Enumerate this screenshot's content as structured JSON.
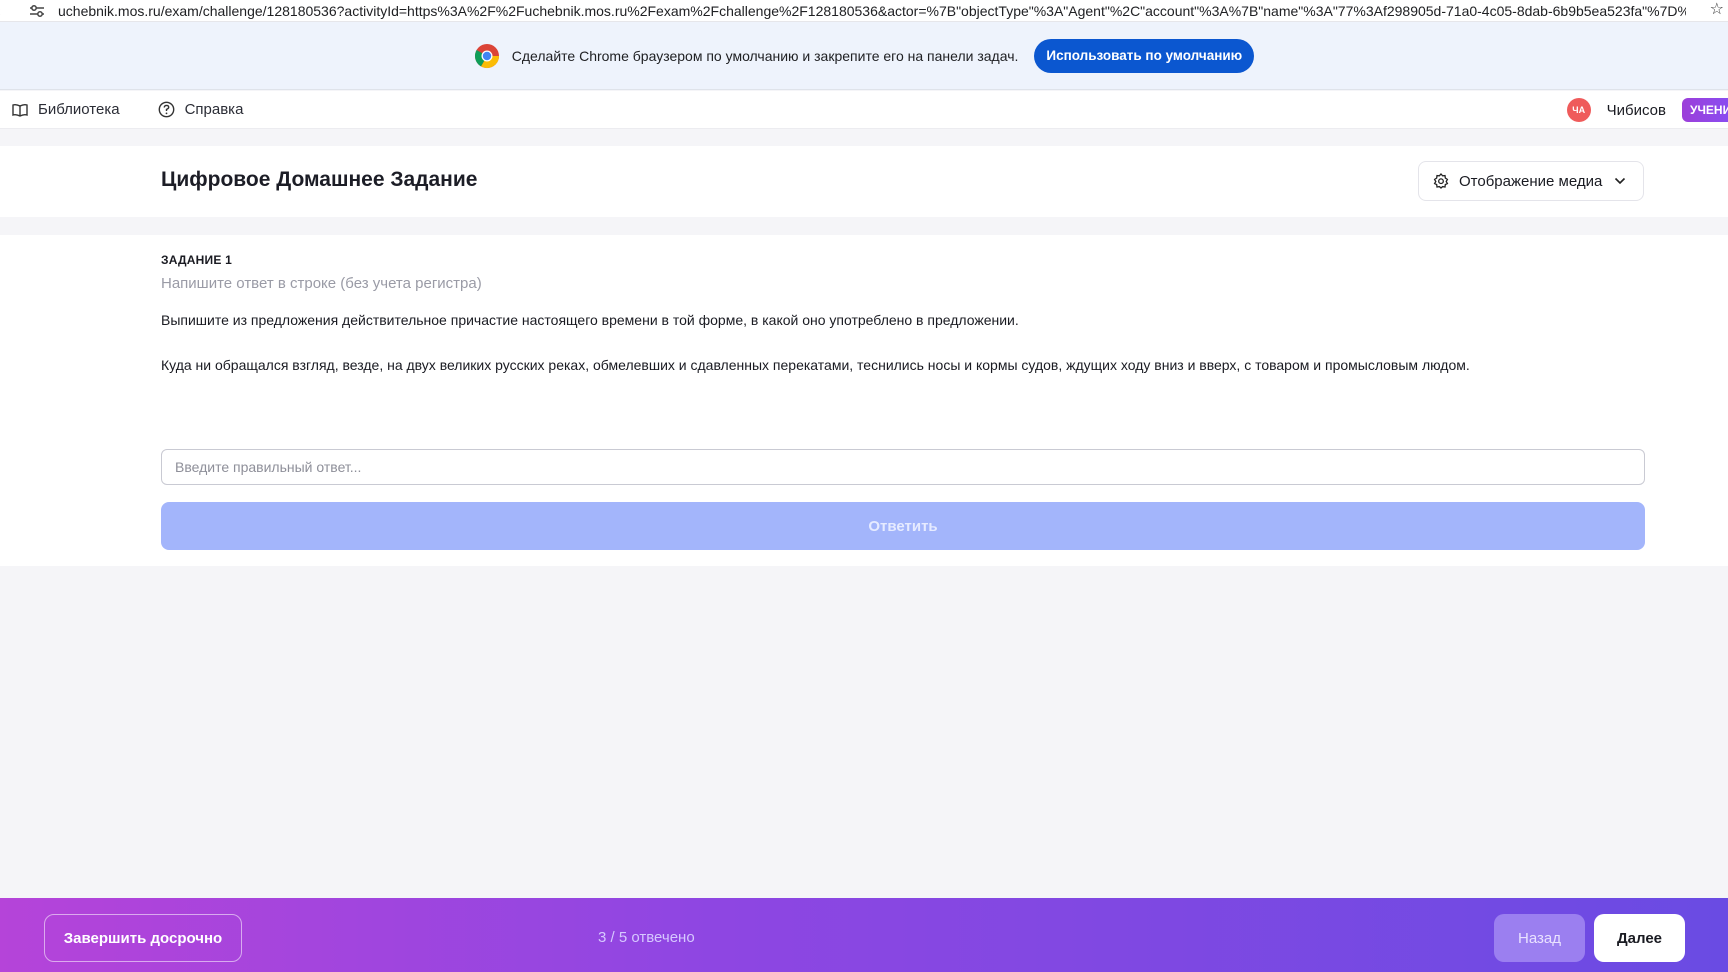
{
  "browser": {
    "url": "uchebnik.mos.ru/exam/challenge/128180536?activityId=https%3A%2F%2Fuchebnik.mos.ru%2Fexam%2Fchallenge%2F128180536&actor=%7B\"objectType\"%3A\"Agent\"%2C\"account\"%3A%7B\"name\"%3A\"77%3Af298905d-71a0-4c05-8dab-6b9b5ea523fa\"%7D%7D..."
  },
  "banner": {
    "text": "Сделайте Chrome браузером по умолчанию и закрепите его на панели задач.",
    "button_label": "Использовать по умолчанию"
  },
  "nav": {
    "library_label": "Библиотека",
    "help_label": "Справка",
    "avatar_initials": "ЧА",
    "username": "Чибисов",
    "role_badge": "УЧЕНИ"
  },
  "header": {
    "title": "Цифровое Домашнее Задание",
    "media_button_label": "Отображение медиа"
  },
  "task": {
    "label": "ЗАДАНИЕ 1",
    "hint": "Напишите ответ в строке (без учета регистра)",
    "question": "Выпишите из предложения действительное причастие настоящего времени в той форме, в какой оно употреблено в предложении.",
    "text": "Куда ни обращался взгляд, везде, на двух великих русских реках, обмелевших и сдавленных перекатами, теснились носы и кормы судов, ждущих ходу вниз и вверх, с товаром и промысловым людом.",
    "answer_placeholder": "Введите правильный ответ...",
    "answer_value": "",
    "submit_label": "Ответить"
  },
  "footer": {
    "finish_label": "Завершить досрочно",
    "progress_text": "3 / 5 отвечено",
    "back_label": "Назад",
    "next_label": "Далее"
  },
  "colors": {
    "accent": "#0b57d0",
    "submit_disabled": "#a3b5fb",
    "footer_gradient_start": "#b544d9",
    "footer_gradient_end": "#6a4be3",
    "avatar": "#ef5b5b"
  }
}
